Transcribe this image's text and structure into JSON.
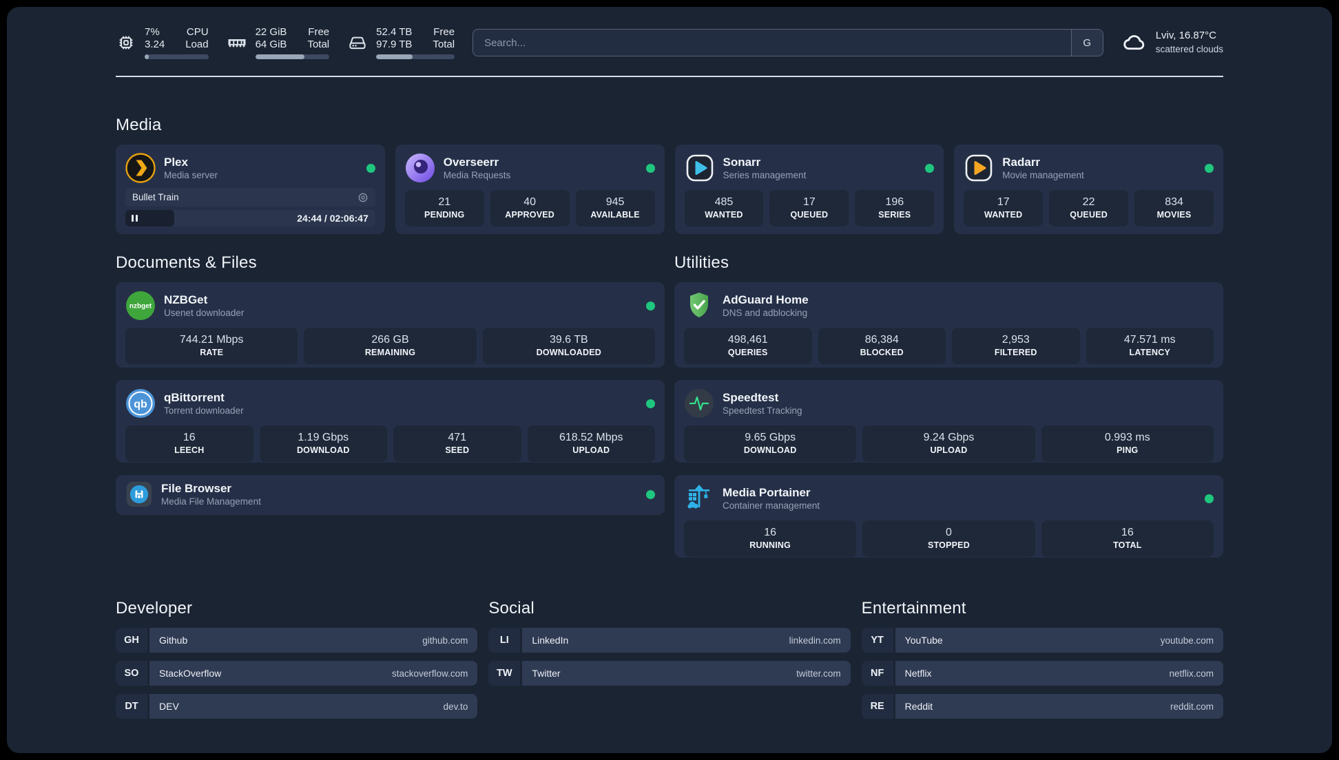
{
  "colors": {
    "background": "#1b2433",
    "card": "#253048",
    "stat_box": "#1e2839",
    "status_online": "#1fc77e",
    "plex_amber": "#e5a00d",
    "sonarr_blue": "#3fbfea",
    "radarr_amber": "#f5a623"
  },
  "header": {
    "stats": [
      {
        "icon": "cpu-chip",
        "value1": "7%",
        "value2": "3.24",
        "label1": "CPU",
        "label2": "Load",
        "progress": 7
      },
      {
        "icon": "memory",
        "value1": "22 GiB",
        "value2": "64 GiB",
        "label1": "Free",
        "label2": "Total",
        "progress": 66
      },
      {
        "icon": "hard-drive",
        "value1": "52.4 TB",
        "value2": "97.9 TB",
        "label1": "Free",
        "label2": "Total",
        "progress": 46
      }
    ],
    "search": {
      "placeholder": "Search...",
      "engine": "G"
    },
    "weather": {
      "location": "Lviv, 16.87°C",
      "condition": "scattered clouds"
    }
  },
  "media": {
    "title": "Media",
    "plex": {
      "name": "Plex",
      "desc": "Media server",
      "online": true,
      "now_playing": {
        "title": "Bullet Train",
        "time": "24:44 / 02:06:47",
        "progress": 19.5
      }
    },
    "overseerr": {
      "name": "Overseerr",
      "desc": "Media Requests",
      "online": true,
      "stats": [
        {
          "value": "21",
          "label": "PENDING"
        },
        {
          "value": "40",
          "label": "APPROVED"
        },
        {
          "value": "945",
          "label": "AVAILABLE"
        }
      ]
    },
    "sonarr": {
      "name": "Sonarr",
      "desc": "Series management",
      "online": true,
      "stats": [
        {
          "value": "485",
          "label": "WANTED"
        },
        {
          "value": "17",
          "label": "QUEUED"
        },
        {
          "value": "196",
          "label": "SERIES"
        }
      ]
    },
    "radarr": {
      "name": "Radarr",
      "desc": "Movie management",
      "online": true,
      "stats": [
        {
          "value": "17",
          "label": "WANTED"
        },
        {
          "value": "22",
          "label": "QUEUED"
        },
        {
          "value": "834",
          "label": "MOVIES"
        }
      ]
    }
  },
  "documents": {
    "title": "Documents & Files",
    "nzbget": {
      "name": "NZBGet",
      "desc": "Usenet downloader",
      "online": true,
      "stats": [
        {
          "value": "744.21 Mbps",
          "label": "RATE"
        },
        {
          "value": "266 GB",
          "label": "REMAINING"
        },
        {
          "value": "39.6 TB",
          "label": "DOWNLOADED"
        }
      ]
    },
    "qbittorrent": {
      "name": "qBittorrent",
      "desc": "Torrent downloader",
      "online": true,
      "stats": [
        {
          "value": "16",
          "label": "LEECH"
        },
        {
          "value": "1.19 Gbps",
          "label": "DOWNLOAD"
        },
        {
          "value": "471",
          "label": "SEED"
        },
        {
          "value": "618.52 Mbps",
          "label": "UPLOAD"
        }
      ]
    },
    "filebrowser": {
      "name": "File Browser",
      "desc": "Media File Management",
      "online": true
    }
  },
  "utilities": {
    "title": "Utilities",
    "adguard": {
      "name": "AdGuard Home",
      "desc": "DNS and adblocking",
      "online": false,
      "stats": [
        {
          "value": "498,461",
          "label": "QUERIES"
        },
        {
          "value": "86,384",
          "label": "BLOCKED"
        },
        {
          "value": "2,953",
          "label": "FILTERED"
        },
        {
          "value": "47.571 ms",
          "label": "LATENCY"
        }
      ]
    },
    "speedtest": {
      "name": "Speedtest",
      "desc": "Speedtest Tracking",
      "online": false,
      "stats": [
        {
          "value": "9.65 Gbps",
          "label": "DOWNLOAD"
        },
        {
          "value": "9.24 Gbps",
          "label": "UPLOAD"
        },
        {
          "value": "0.993 ms",
          "label": "PING"
        }
      ]
    },
    "portainer": {
      "name": "Media Portainer",
      "desc": "Container management",
      "online": true,
      "stats": [
        {
          "value": "16",
          "label": "RUNNING"
        },
        {
          "value": "0",
          "label": "STOPPED"
        },
        {
          "value": "16",
          "label": "TOTAL"
        }
      ]
    }
  },
  "bookmarks": [
    {
      "title": "Developer",
      "items": [
        {
          "abbr": "GH",
          "name": "Github",
          "url": "github.com"
        },
        {
          "abbr": "SO",
          "name": "StackOverflow",
          "url": "stackoverflow.com"
        },
        {
          "abbr": "DT",
          "name": "DEV",
          "url": "dev.to"
        }
      ]
    },
    {
      "title": "Social",
      "items": [
        {
          "abbr": "LI",
          "name": "LinkedIn",
          "url": "linkedin.com"
        },
        {
          "abbr": "TW",
          "name": "Twitter",
          "url": "twitter.com"
        }
      ]
    },
    {
      "title": "Entertainment",
      "items": [
        {
          "abbr": "YT",
          "name": "YouTube",
          "url": "youtube.com"
        },
        {
          "abbr": "NF",
          "name": "Netflix",
          "url": "netflix.com"
        },
        {
          "abbr": "RE",
          "name": "Reddit",
          "url": "reddit.com"
        }
      ]
    }
  ]
}
